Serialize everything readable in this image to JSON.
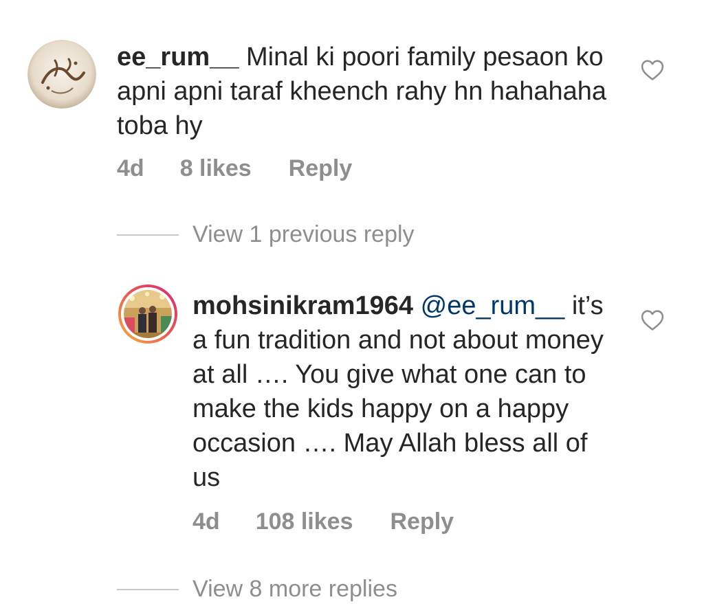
{
  "comments": [
    {
      "username": "ee_rum__",
      "text": "Minal ki poori family pesaon ko apni apni taraf kheench rahy hn hahahaha toba hy",
      "time": "4d",
      "likes": "8 likes",
      "reply_label": "Reply"
    },
    {
      "username": "mohsinikram1964",
      "mention": "@ee_rum__",
      "text": "it’s a fun tradition and not about money at all …. You give what one can to make the kids happy on a happy occasion …. May Allah bless all of us",
      "time": "4d",
      "likes": "108 likes",
      "reply_label": "Reply"
    }
  ],
  "view_previous_replies": "View 1 previous reply",
  "view_more_replies": "View 8 more replies",
  "icons": {
    "like": "heart-outline-icon",
    "avatar_1": "calligraphy-avatar",
    "avatar_2": "photo-avatar"
  },
  "colors": {
    "text": "#262626",
    "muted": "#8e8e8e",
    "mention": "#00376b",
    "story_ring_start": "#f9b33f",
    "story_ring_end": "#d62976"
  }
}
